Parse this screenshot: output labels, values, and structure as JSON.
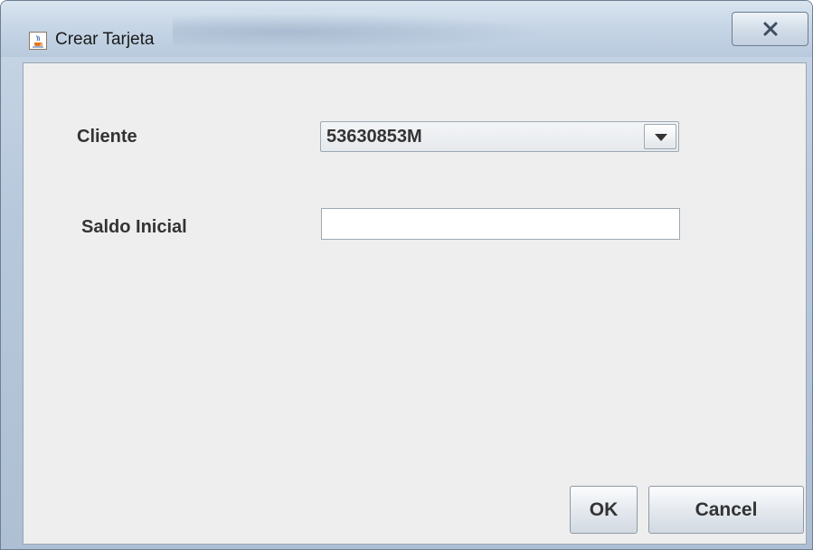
{
  "window": {
    "title": "Crear Tarjeta",
    "icon": "java-cup-icon",
    "close_icon": "close-icon"
  },
  "form": {
    "cliente_label": "Cliente",
    "cliente_value": "53630853M",
    "saldo_label": "Saldo Inicial",
    "saldo_value": ""
  },
  "buttons": {
    "ok_label": "OK",
    "cancel_label": "Cancel"
  },
  "colors": {
    "client_area": "#eeeeee",
    "titlebar": "#c5d5e6",
    "text": "#333333"
  }
}
